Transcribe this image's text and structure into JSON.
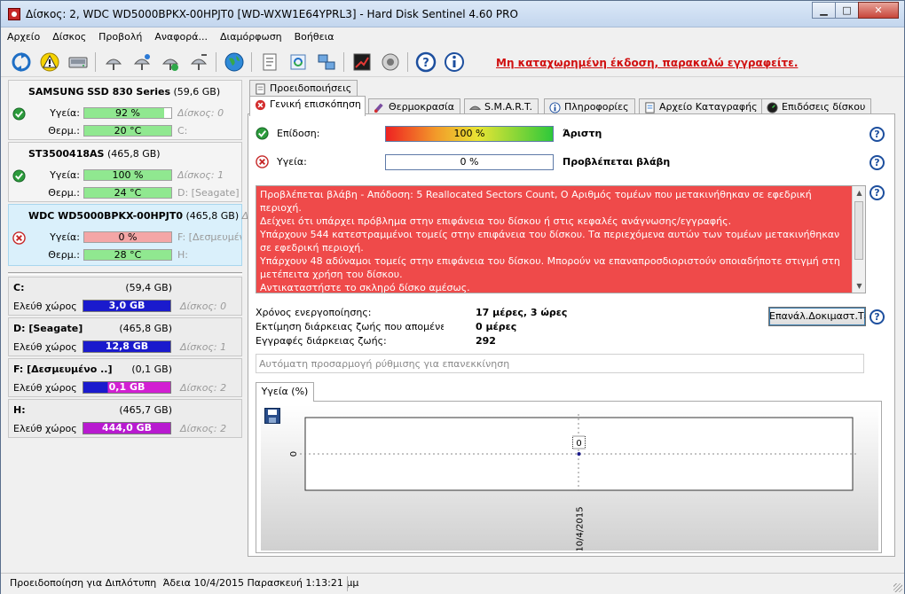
{
  "window": {
    "title": "Δίσκος: 2, WDC WD5000BPKX-00HPJT0 [WD-WXW1E64YPRL3]  -  Hard Disk Sentinel 4.60 PRO",
    "minimize": "▁",
    "maximize": "□",
    "close": "✕"
  },
  "menu": [
    "Αρχείο",
    "Δίσκος",
    "Προβολή",
    "Αναφορά...",
    "Διαμόρφωση",
    "Βοήθεια"
  ],
  "register_link": "Μη καταχωρημένη έκδοση, παρακαλώ εγγραφείτε.",
  "disks": [
    {
      "name": "SAMSUNG SSD 830 Series",
      "size": "(59,6 GB)",
      "status": "ok",
      "health_label": "Υγεία:",
      "health": "92 %",
      "health_pct": 92,
      "health_extra": "Δίσκος: 0",
      "temp_label": "Θερμ.:",
      "temp": "20 °C",
      "temp_extra": "C:"
    },
    {
      "name": "ST3500418AS",
      "size": "(465,8 GB)",
      "status": "ok",
      "health_label": "Υγεία:",
      "health": "100 %",
      "health_pct": 100,
      "health_extra": "Δίσκος: 1",
      "temp_label": "Θερμ.:",
      "temp": "24 °C",
      "temp_extra": "D: [Seagate]"
    },
    {
      "name": "WDC WD5000BPKX-00HPJT0",
      "size": "(465,8 GB)",
      "size_extra": "Δίσ",
      "status": "bad",
      "health_label": "Υγεία:",
      "health": "0 %",
      "health_pct": 0,
      "health_extra": "F: [Δεσμευμέν",
      "temp_label": "Θερμ.:",
      "temp": "28 °C",
      "temp_extra": "H:"
    }
  ],
  "volumes": [
    {
      "name": "C:",
      "size": "(59,4 GB)",
      "free_label": "Ελεύθ χώρος",
      "free": "3,0 GB",
      "disk": "Δίσκος: 0",
      "color": "#1a1acd"
    },
    {
      "name": "D: [Seagate]",
      "size": "(465,8 GB)",
      "free_label": "Ελεύθ χώρος",
      "free": "12,8 GB",
      "disk": "Δίσκος: 1",
      "color": "#1a1acd"
    },
    {
      "name": "F: [Δεσμευμένο ..]",
      "size": "(0,1 GB)",
      "free_label": "Ελεύθ χώρος",
      "free": "0,1 GB",
      "disk": "Δίσκος: 2",
      "color": "#d21fd2"
    },
    {
      "name": "H:",
      "size": "(465,7 GB)",
      "free_label": "Ελεύθ χώρος",
      "free": "444,0 GB",
      "disk": "Δίσκος: 2",
      "color": "#b81ad0"
    }
  ],
  "tabs": {
    "top": "Προειδοποιήσεις",
    "items": [
      "Γενική επισκόπηση",
      "Θερμοκρασία",
      "S.M.A.R.T.",
      "Πληροφορίες",
      "Αρχείο Καταγραφής",
      "Επιδόσεις δίσκου"
    ]
  },
  "overview": {
    "perf_label": "Επίδοση:",
    "perf_value": "100 %",
    "perf_pct": 100,
    "perf_result": "Άριστη",
    "health_label": "Υγεία:",
    "health_value": "0 %",
    "health_pct": 0,
    "health_result": "Προβλέπεται βλάβη",
    "help": "?",
    "alert_lines": [
      "Προβλέπεται βλάβη - Απόδοση: 5 Reallocated Sectors Count, Ο Αριθμός τομέων που μετακινήθηκαν σε εφεδρική περιοχή.",
      "Δείχνει ότι υπάρχει πρόβλημα στην επιφάνεια του δίσκου ή στις κεφαλές ανάγνωσης/εγγραφής.",
      "Υπάρχουν 544 κατεστραμμένοι τομείς στην επιφάνεια του δίσκου. Τα περιεχόμενα αυτών των τομέων μετακινήθηκαν σε εφεδρική περιοχή.",
      "Υπάρχουν 48 αδύναμοι τομείς στην επιφάνεια του δίσκου. Μπορούν να επαναπροσδιοριστούν οποιαδήποτε στιγμή στη μετέπειτα χρήση του δίσκου.",
      "Αντικαταστήστε το σκληρό δίσκο αμέσως."
    ],
    "info": [
      {
        "label": "Χρόνος ενεργοποίησης:",
        "value": "17 μέρες, 3 ώρες"
      },
      {
        "label": "Εκτίμηση διάρκειας ζωής που απομένει:",
        "value": "0 μέρες"
      },
      {
        "label": "Εγγραφές διάρκειας ζωής:",
        "value": "292"
      }
    ],
    "test_button": "Επανάλ.Δοκιμαστ.Τεστ",
    "auto_field": "Αυτόματη προσαρμογή ρύθμισης για επανεκκίνηση",
    "chart_tab": "Υγεία (%)"
  },
  "chart_data": {
    "type": "line",
    "title": "Υγεία (%)",
    "x": [
      "10/4/2015"
    ],
    "series": [
      {
        "values": [
          0
        ]
      }
    ],
    "y_tick_labels": [
      "0"
    ],
    "data_labels": [
      "0"
    ],
    "grid": true
  },
  "statusbar": {
    "text1": "Προειδοποίηση για Διπλότυπη",
    "text2": "Άδεια 10/4/2015 Παρασκευή 1:13:21 μμ"
  }
}
